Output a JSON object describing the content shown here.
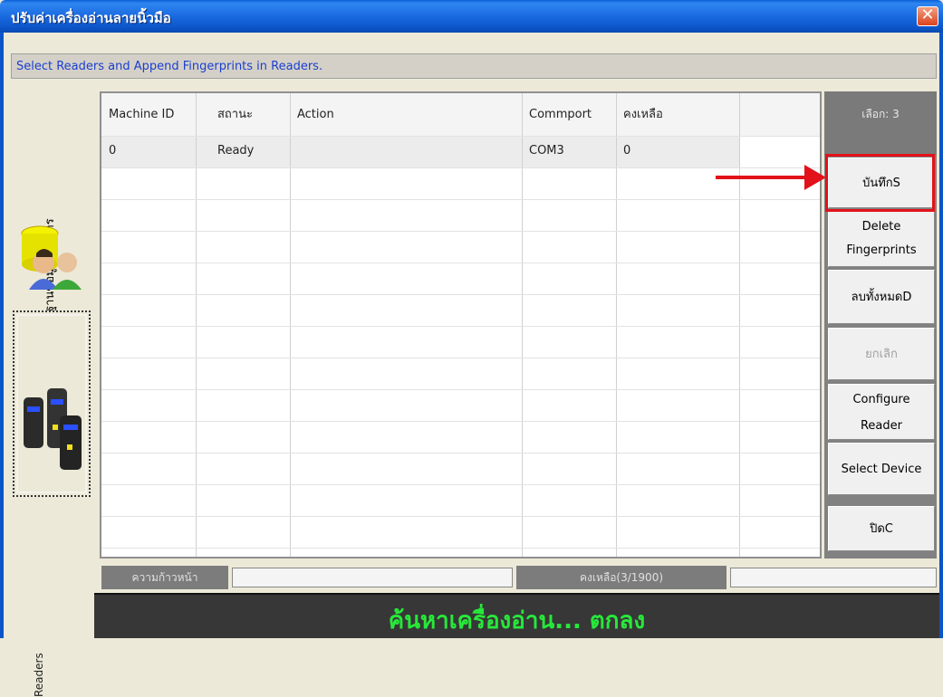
{
  "window": {
    "title": "ปรับค่าเครื่องอ่านลายนิ้วมือ",
    "close_label": "✕"
  },
  "info_bar": {
    "text": "Select Readers and Append Fingerprints in Readers."
  },
  "sidebar": {
    "tabs": [
      {
        "label": "ฐานข้อมูลผู้ถือบัตร",
        "icon": "users-database-icon"
      },
      {
        "label": "Readers",
        "icon": "fingerprint-readers-icon"
      }
    ]
  },
  "table": {
    "columns": [
      "Machine ID",
      "สถานะ",
      "Action",
      "Commport",
      "คงเหลือ",
      ""
    ],
    "rows": [
      [
        "0",
        "Ready",
        "",
        "COM3",
        "0",
        ""
      ]
    ]
  },
  "right_panel": {
    "selected_label": "เลือก: 3",
    "buttons": {
      "save": "บันทึกS",
      "delete_fp_1": "Delete",
      "delete_fp_2": "Fingerprints",
      "delete_all": "ลบทั้งหมดD",
      "cancel": "ยกเลิก",
      "configure_1": "Configure",
      "configure_2": "Reader",
      "select_device": "Select Device",
      "close": "ปิดC"
    }
  },
  "status": {
    "progress_label": "ความก้าวหน้า",
    "remaining_label": "คงเหลือ(3/1900)",
    "message": "ค้นหาเครื่องอ่าน... ตกลง"
  },
  "colors": {
    "title_bar": "#1a6ae0",
    "highlight": "#e2121a",
    "status_message": "#27e83a"
  }
}
